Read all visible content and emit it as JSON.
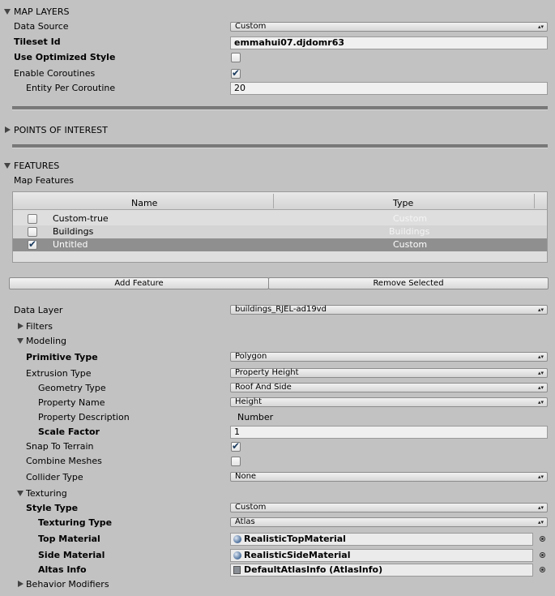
{
  "sections": {
    "map_layers": "MAP LAYERS",
    "points_of_interest": "POINTS OF INTEREST",
    "features": "FEATURES"
  },
  "map_layers": {
    "data_source_label": "Data Source",
    "data_source_value": "Custom",
    "tileset_label": "Tileset Id",
    "tileset_value": "emmahui07.djdomr63",
    "optimized_label": "Use Optimized Style",
    "optimized_checked": false,
    "coroutines_label": "Enable Coroutines",
    "coroutines_checked": true,
    "entity_label": "Entity Per Coroutine",
    "entity_value": "20"
  },
  "features": {
    "map_features_label": "Map Features",
    "columns": [
      "Name",
      "Type"
    ],
    "rows": [
      {
        "name": "Custom-true",
        "type": "Custom",
        "checked": false
      },
      {
        "name": "Buildings",
        "type": "Buildings",
        "checked": false
      },
      {
        "name": "Untitled",
        "type": "Custom",
        "checked": true
      }
    ],
    "add_button": "Add Feature",
    "remove_button": "Remove Selected"
  },
  "layer": {
    "data_layer_label": "Data Layer",
    "data_layer_value": "buildings_RJEL-ad19vd",
    "filters_label": "Filters",
    "modeling_label": "Modeling",
    "primitive_label": "Primitive Type",
    "primitive_value": "Polygon",
    "extrusion_label": "Extrusion Type",
    "extrusion_value": "Property Height",
    "geometry_label": "Geometry Type",
    "geometry_value": "Roof And Side",
    "property_name_label": "Property Name",
    "property_name_value": "Height",
    "property_desc_label": "Property Description",
    "property_desc_value": "Number",
    "scale_label": "Scale Factor",
    "scale_value": "1",
    "snap_label": "Snap To Terrain",
    "snap_checked": true,
    "combine_label": "Combine Meshes",
    "combine_checked": false,
    "collider_label": "Collider Type",
    "collider_value": "None",
    "texturing_label": "Texturing",
    "style_label": "Style Type",
    "style_value": "Custom",
    "texturing_type_label": "Texturing Type",
    "texturing_type_value": "Atlas",
    "top_material_label": "Top Material",
    "top_material_value": "RealisticTopMaterial",
    "side_material_label": "Side Material",
    "side_material_value": "RealisticSideMaterial",
    "atlas_label": "Altas Info",
    "atlas_value": "DefaultAtlasInfo (AtlasInfo)",
    "behavior_label": "Behavior Modifiers"
  },
  "icons": {
    "dropdown": "updown-arrows-icon",
    "check": "checkmark-icon",
    "material": "sphere-material-icon",
    "asset": "scriptable-asset-icon",
    "picker": "object-picker-icon"
  },
  "colors": {
    "background": "#c2c2c2",
    "selected_row": "#8f8f8f",
    "check_mark": "#1a3a5e"
  }
}
